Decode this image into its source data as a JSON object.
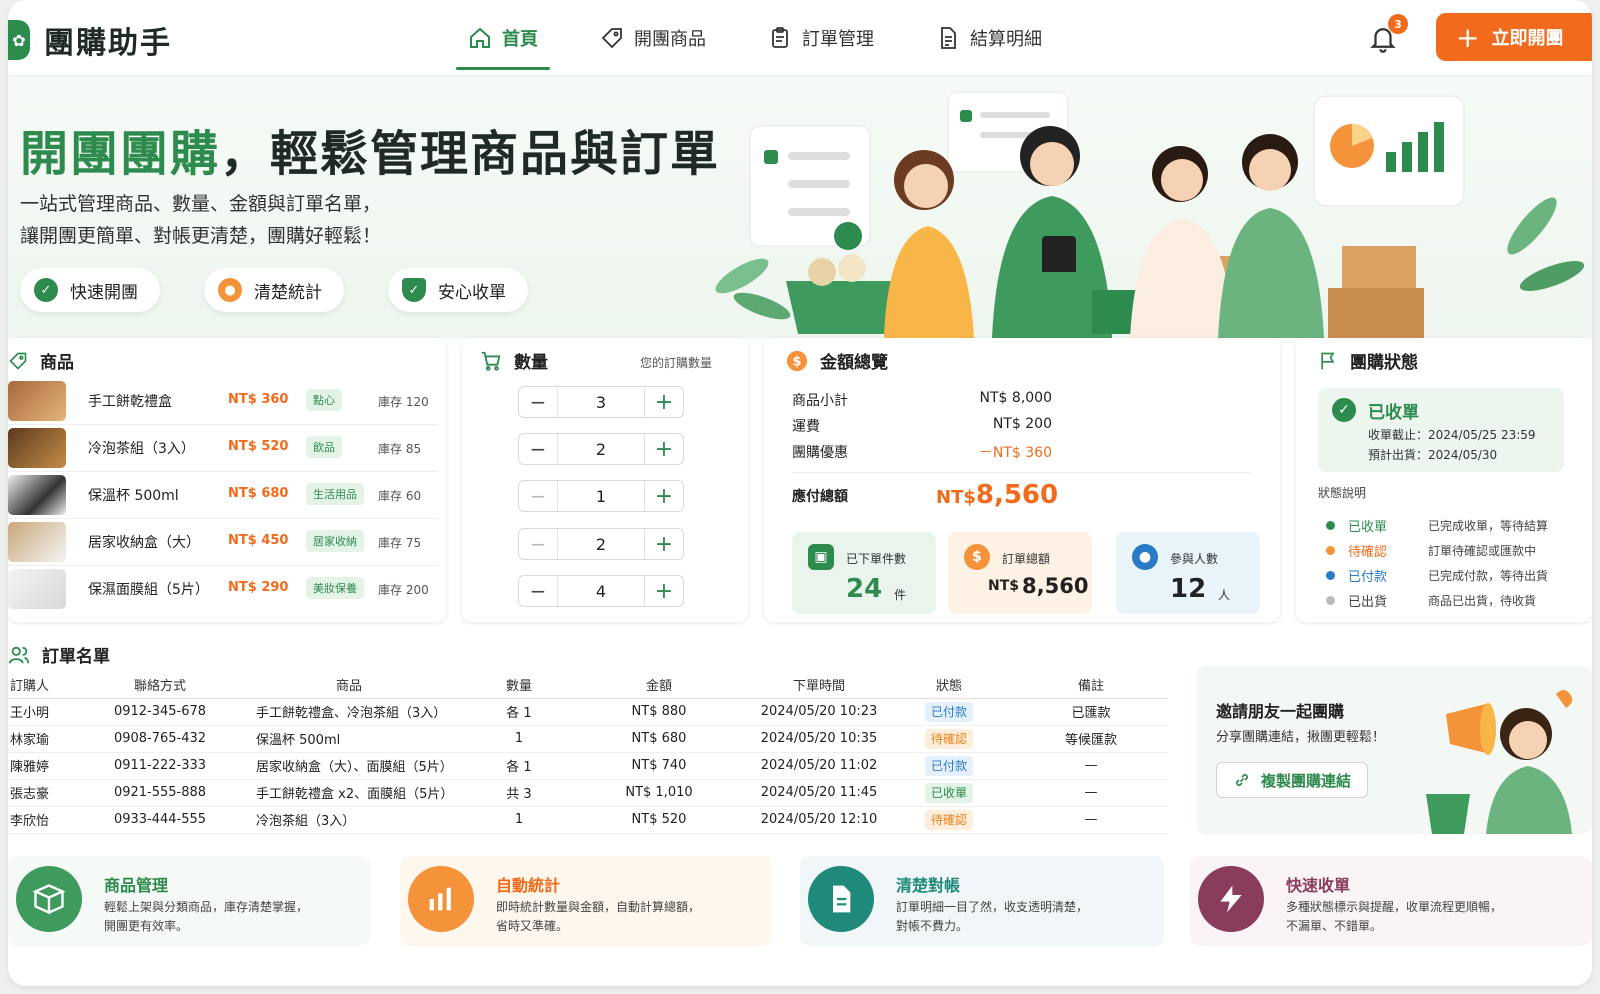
{
  "app": {
    "name": "團購助手"
  },
  "nav": [
    {
      "label": "首頁",
      "icon": "home-icon"
    },
    {
      "label": "開團商品",
      "icon": "tag-icon"
    },
    {
      "label": "訂單管理",
      "icon": "clipboard-icon"
    },
    {
      "label": "結算明細",
      "icon": "document-icon"
    }
  ],
  "header": {
    "notifications": "3",
    "cta_label": "立即開團"
  },
  "hero": {
    "title_green": "開團團購",
    "title_rest": "，輕鬆管理商品與訂單",
    "sub1": "一站式管理商品、數量、金額與訂單名單，",
    "sub2": "讓開團更簡單、對帳更清楚，團購好輕鬆！",
    "chips": [
      {
        "label": "快速開團",
        "icon": "check-circle-icon",
        "color": "#2e8b4e"
      },
      {
        "label": "清楚統計",
        "icon": "users-icon",
        "color": "#f5933b"
      },
      {
        "label": "安心收單",
        "icon": "shield-check-icon",
        "color": "#2e8b4e"
      }
    ]
  },
  "products": {
    "title": "商品",
    "items": [
      {
        "name": "手工餅乾禮盒",
        "price": "NT$ 360",
        "tag": "點心",
        "stock": "庫存 120"
      },
      {
        "name": "冷泡茶組（3入）",
        "price": "NT$ 520",
        "tag": "飲品",
        "stock": "庫存 85"
      },
      {
        "name": "保溫杯 500ml",
        "price": "NT$ 680",
        "tag": "生活用品",
        "stock": "庫存 60"
      },
      {
        "name": "居家收納盒（大）",
        "price": "NT$ 450",
        "tag": "居家收納",
        "stock": "庫存 75"
      },
      {
        "name": "保濕面膜組（5片）",
        "price": "NT$ 290",
        "tag": "美妝保養",
        "stock": "庫存 200"
      }
    ]
  },
  "quantity": {
    "title": "數量",
    "sub": "您的訂購數量",
    "values": [
      "3",
      "2",
      "1",
      "2",
      "4"
    ]
  },
  "summary": {
    "title": "金額總覽",
    "rows": [
      {
        "label": "商品小計",
        "value": "NT$ 8,000"
      },
      {
        "label": "運費",
        "value": "NT$ 200"
      },
      {
        "label": "團購優惠",
        "value": "－NT$ 360"
      }
    ],
    "total_label": "應付總額",
    "total_prefix": "NT$",
    "total_value": "8,560",
    "stats": [
      {
        "label": "已下單件數",
        "value": "24",
        "unit": "件"
      },
      {
        "label": "訂單總額",
        "prefix": "NT$",
        "value": "8,560"
      },
      {
        "label": "參與人數",
        "value": "12",
        "unit": "人"
      }
    ]
  },
  "status": {
    "title": "團購狀態",
    "current": "已收單",
    "deadline": "收單截止：2024/05/25 23:59",
    "ship": "預計出貨：2024/05/30",
    "legend_title": "狀態說明",
    "legend": [
      {
        "name": "已收單",
        "desc": "已完成收單，等待結算",
        "color": "#2e8b4e"
      },
      {
        "name": "待確認",
        "desc": "訂單待確認或匯款中",
        "color": "#f5933b"
      },
      {
        "name": "已付款",
        "desc": "已完成付款，等待出貨",
        "color": "#2a7bc7"
      },
      {
        "name": "已出貨",
        "desc": "商品已出貨，待收貨",
        "color": "#bbbbbb"
      }
    ]
  },
  "orders": {
    "title": "訂單名單",
    "headers": [
      "訂購人",
      "聯絡方式",
      "商品",
      "數量",
      "金額",
      "下單時間",
      "狀態",
      "備註"
    ],
    "rows": [
      [
        "王小明",
        "0912-345-678",
        "手工餅乾禮盒、冷泡茶組（3入）",
        "各 1",
        "NT$ 880",
        "2024/05/20 10:23",
        "已付款",
        "已匯款"
      ],
      [
        "林家瑜",
        "0908-765-432",
        "保溫杯 500ml",
        "1",
        "NT$ 680",
        "2024/05/20 10:35",
        "待確認",
        "等候匯款"
      ],
      [
        "陳雅婷",
        "0911-222-333",
        "居家收納盒（大）、面膜組（5片）",
        "各 1",
        "NT$ 740",
        "2024/05/20 11:02",
        "已付款",
        "—"
      ],
      [
        "張志豪",
        "0921-555-888",
        "手工餅乾禮盒 x2、面膜組（5片）",
        "共 3",
        "NT$ 1,010",
        "2024/05/20 11:45",
        "已收單",
        "—"
      ],
      [
        "李欣怡",
        "0933-444-555",
        "冷泡茶組（3入）",
        "1",
        "NT$ 520",
        "2024/05/20 12:10",
        "待確認",
        "—"
      ]
    ]
  },
  "invite": {
    "title": "邀請朋友一起團購",
    "sub": "分享團購連結，揪團更輕鬆！",
    "button": "複製團購連結"
  },
  "features": [
    {
      "title": "商品管理",
      "desc1": "輕鬆上架與分類商品，庫存清楚掌握，",
      "desc2": "開團更有效率。",
      "color": "#2e8b4e",
      "icon": "box-icon"
    },
    {
      "title": "自動統計",
      "desc1": "即時統計數量與金額，自動計算總額，",
      "desc2": "省時又準確。",
      "color": "#f26a1b",
      "icon": "bar-chart-icon"
    },
    {
      "title": "清楚對帳",
      "desc1": "訂單明細一目了然，收支透明清楚，",
      "desc2": "對帳不費力。",
      "color": "#1f8a7a",
      "icon": "document-icon"
    },
    {
      "title": "快速收單",
      "desc1": "多種狀態標示與提醒，收單流程更順暢，",
      "desc2": "不漏單、不錯單。",
      "color": "#8a3c5c",
      "icon": "lightning-icon"
    }
  ]
}
